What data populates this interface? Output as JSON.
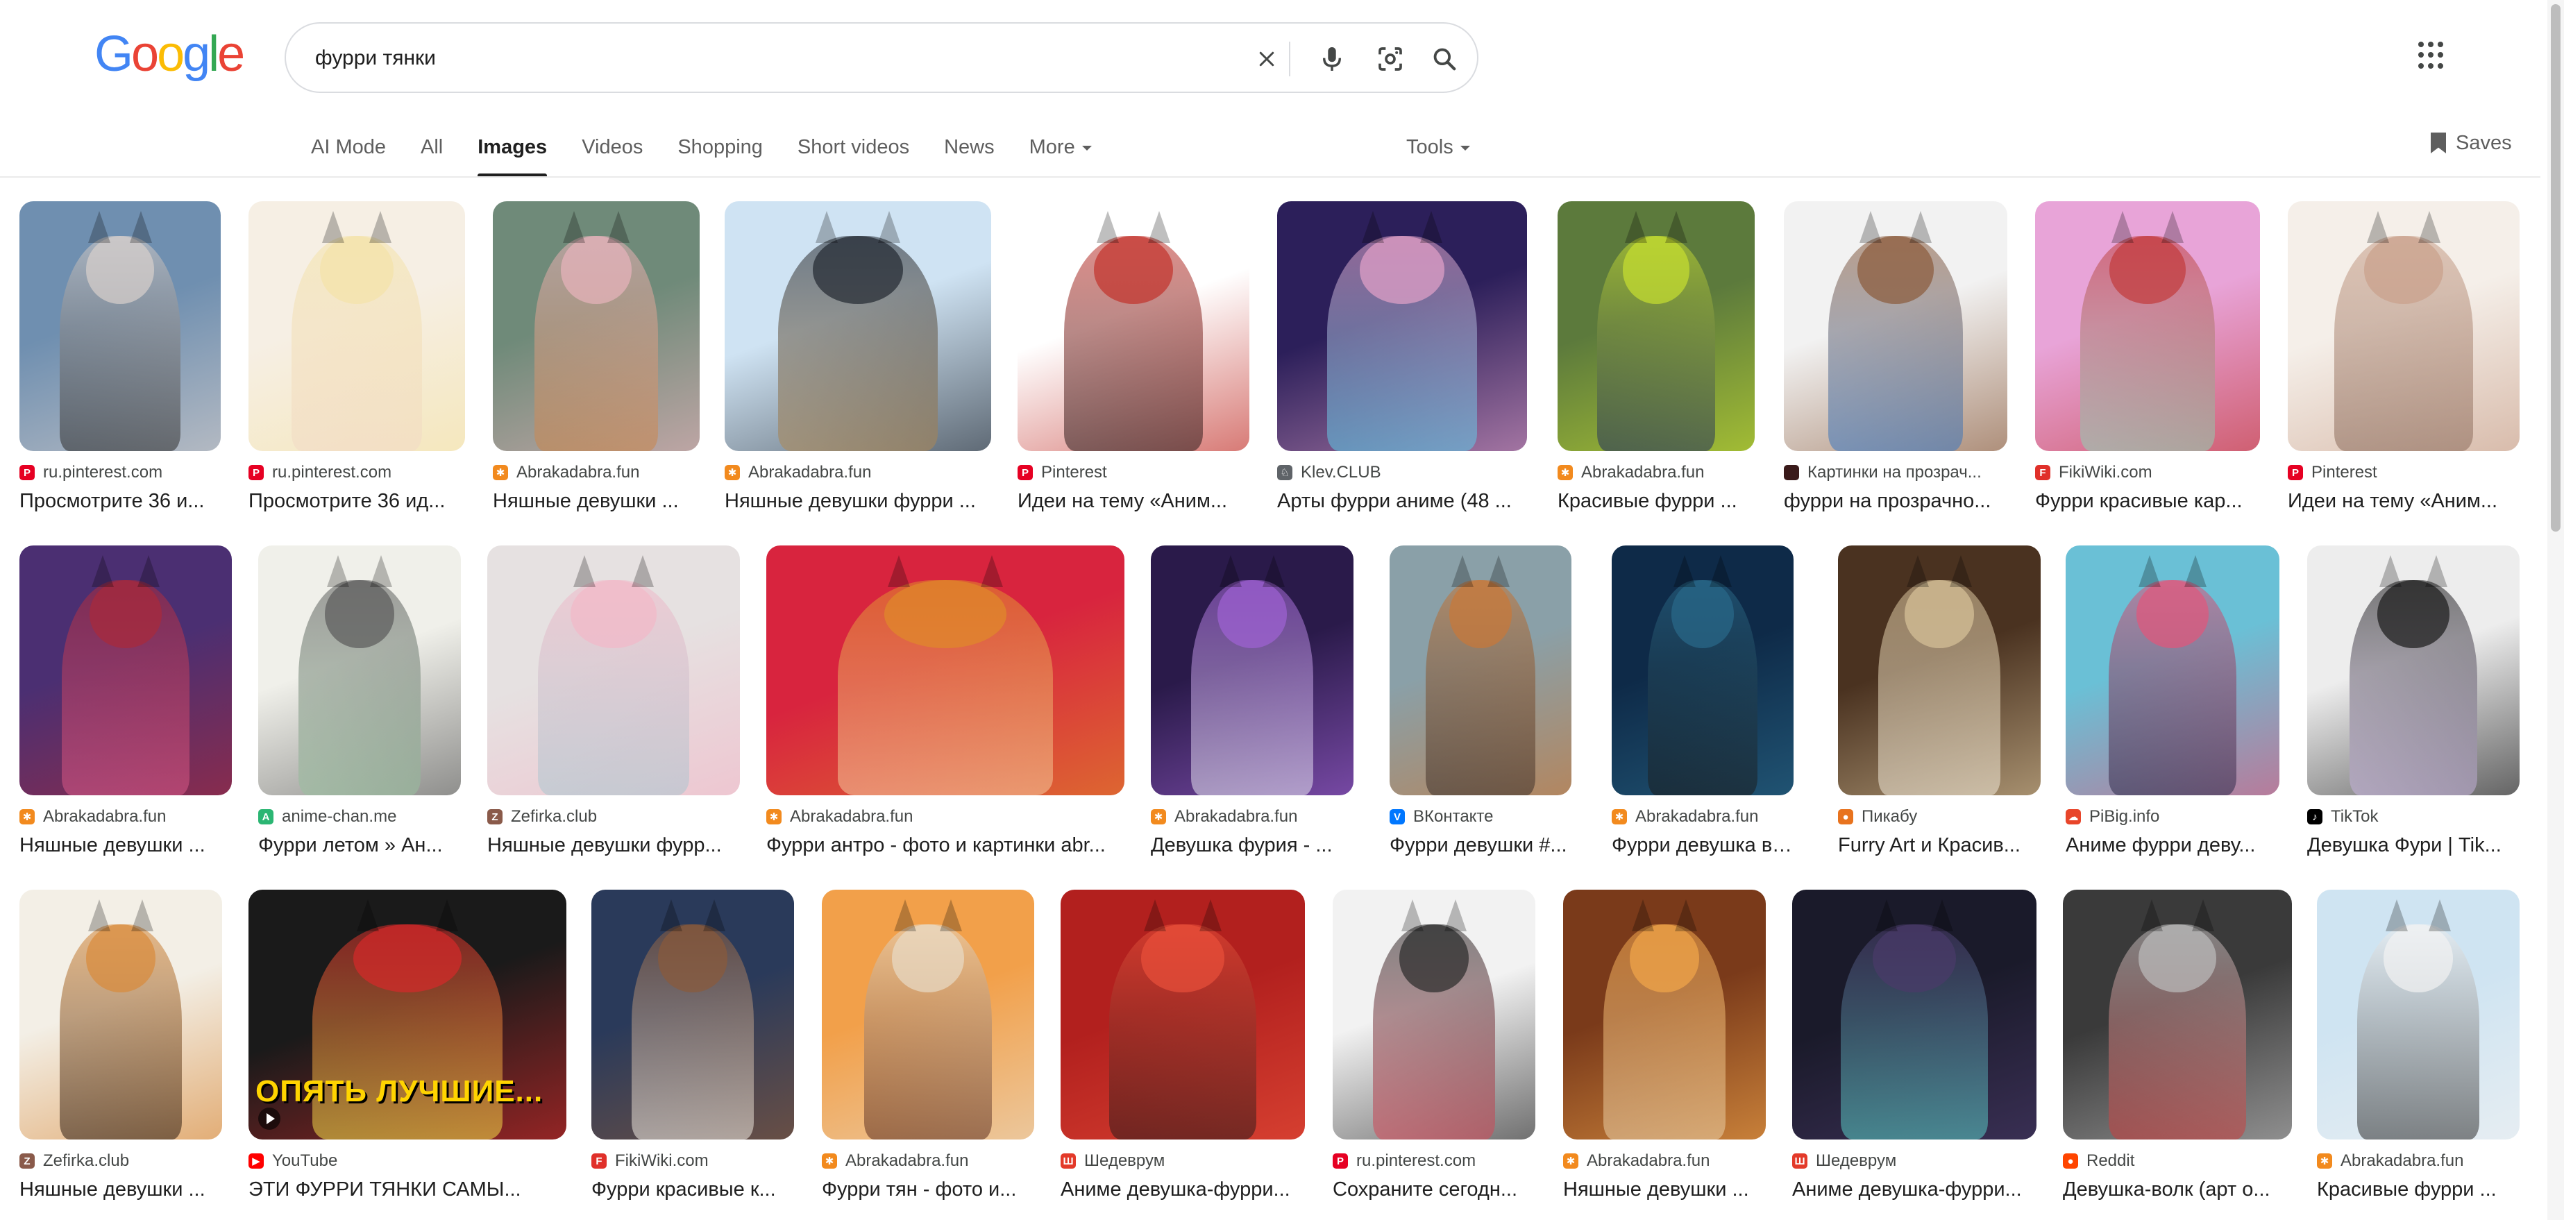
{
  "logo": {
    "letters": [
      "G",
      "o",
      "o",
      "g",
      "l",
      "e"
    ],
    "colors": [
      "#4285F4",
      "#EA4335",
      "#FBBC05",
      "#4285F4",
      "#34A853",
      "#EA4335"
    ]
  },
  "search": {
    "query": "фурри тянки",
    "clear_icon": "close-icon",
    "voice_icon": "mic-icon",
    "lens_icon": "camera-icon",
    "search_icon": "search-icon"
  },
  "tabs": [
    {
      "label": "AI Mode",
      "active": false
    },
    {
      "label": "All",
      "active": false
    },
    {
      "label": "Images",
      "active": true
    },
    {
      "label": "Videos",
      "active": false
    },
    {
      "label": "Shopping",
      "active": false
    },
    {
      "label": "Short videos",
      "active": false
    },
    {
      "label": "News",
      "active": false
    },
    {
      "label": "More",
      "active": false,
      "dropdown": true
    }
  ],
  "tools_label": "Tools",
  "saves_label": "Saves",
  "results": [
    [
      {
        "source": "ru.pinterest.com",
        "fav": "pinterest",
        "title": "Просмотрите 36 и...",
        "colors": [
          "#6f8fb0",
          "#d8d0cc",
          "#2a2a2a"
        ]
      },
      {
        "source": "ru.pinterest.com",
        "fav": "pinterest",
        "title": "Просмотрите 36 ид...",
        "colors": [
          "#f6efe4",
          "#f4e3a8",
          "#f1d9c6"
        ]
      },
      {
        "source": "Abrakadabra.fun",
        "fav": "abrakadabra",
        "title": "Няшные девушки ...",
        "colors": [
          "#6f8a79",
          "#e8b4bc",
          "#c88448"
        ]
      },
      {
        "source": "Abrakadabra.fun",
        "fav": "abrakadabra",
        "title": "Няшные девушки фурри ...",
        "colors": [
          "#cfe3f3",
          "#222831",
          "#b08a55"
        ]
      },
      {
        "source": "Pinterest",
        "fav": "pinterest",
        "title": "Идеи на тему «Аним...",
        "colors": [
          "#ffffff",
          "#c2322b",
          "#2a1c1c"
        ]
      },
      {
        "source": "Klev.CLUB",
        "fav": "klev",
        "title": "Арты фурри аниме (48 ...",
        "colors": [
          "#2c1f5a",
          "#e4a3c9",
          "#5ac9e6"
        ]
      },
      {
        "source": "Abrakadabra.fun",
        "fav": "abrakadabra",
        "title": "Красивые фурри ...",
        "colors": [
          "#5c7a3c",
          "#c8e030",
          "#1d2b5e"
        ]
      },
      {
        "source": "Картинки на прозрач...",
        "fav": "dark",
        "title": "фурри на прозрачно...",
        "colors": [
          "#f2f2f2",
          "#8a5a3a",
          "#3b78c2"
        ]
      },
      {
        "source": "FikiWiki.com",
        "fav": "fikiwiki",
        "title": "Фурри красивые кар...",
        "colors": [
          "#e8a4d8",
          "#c23a3a",
          "#8fd6b8"
        ]
      },
      {
        "source": "Pinterest",
        "fav": "pinterest",
        "title": "Идеи на тему «Аним...",
        "colors": [
          "#f5efe9",
          "#c9a08a",
          "#8a6a5a"
        ]
      }
    ],
    [
      {
        "source": "Abrakadabra.fun",
        "fav": "abrakadabra",
        "title": "Няшные девушки ...",
        "colors": [
          "#4b2f72",
          "#a92a3a",
          "#d95a8a"
        ]
      },
      {
        "source": "anime-chan.me",
        "fav": "animechan",
        "title": "Фурри летом » Ан...",
        "colors": [
          "#f0f0ea",
          "#5a5a5a",
          "#9ac2a0"
        ]
      },
      {
        "source": "Zefirka.club",
        "fav": "zefirka",
        "title": "Няшные девушки фурр...",
        "colors": [
          "#e6e1e1",
          "#f2b8c8",
          "#a9c7d0"
        ]
      },
      {
        "source": "Abrakadabra.fun",
        "fav": "abrakadabra",
        "title": "Фурри антро - фото и картинки abr...",
        "colors": [
          "#d8243e",
          "#e08a2a",
          "#f5c9a0"
        ]
      },
      {
        "source": "Abrakadabra.fun",
        "fav": "abrakadabra",
        "title": "Девушка фурия - ...",
        "colors": [
          "#2a1a4a",
          "#a062d4",
          "#e6e6f0"
        ]
      },
      {
        "source": "ВКонтакте",
        "fav": "vk",
        "title": "Фурри девушки #...",
        "colors": [
          "#8aa0a8",
          "#c97838",
          "#3a2f2a"
        ]
      },
      {
        "source": "Abrakadabra.fun",
        "fav": "abrakadabra",
        "title": "Фурри девушка во...",
        "colors": [
          "#0e2a48",
          "#2a6a8a",
          "#1a1a1a"
        ]
      },
      {
        "source": "Пикабу",
        "fav": "pikabu",
        "title": "Furry Art и Красив...",
        "colors": [
          "#4a3220",
          "#d9c39a",
          "#f0e8d8"
        ]
      },
      {
        "source": "PiBig.info",
        "fav": "pibig",
        "title": "Аниме фурри деву...",
        "colors": [
          "#6ac0d6",
          "#e2557a",
          "#2a2a4a"
        ]
      },
      {
        "source": "TikTok",
        "fav": "tiktok",
        "title": "Девушка Фури | Tik...",
        "colors": [
          "#ededed",
          "#1a1a1a",
          "#c9b6e0"
        ]
      }
    ],
    [
      {
        "source": "Zefirka.club",
        "fav": "zefirka",
        "title": "Няшные девушки ...",
        "colors": [
          "#f3efe6",
          "#d98a3a",
          "#2a1a10"
        ]
      },
      {
        "source": "YouTube",
        "fav": "youtube",
        "title": "ЭТИ ФУРРИ ТЯНКИ САМЫ...",
        "colors": [
          "#1a1a1a",
          "#d62a2a",
          "#f2e04a"
        ],
        "video": true,
        "caption": "ОПЯТЬ ЛУЧШИЕ..."
      },
      {
        "source": "FikiWiki.com",
        "fav": "fikiwiki",
        "title": "Фурри красивые к...",
        "colors": [
          "#2a3a5a",
          "#8a5a3a",
          "#f0ece4"
        ]
      },
      {
        "source": "Abrakadabra.fun",
        "fav": "abrakadabra",
        "title": "Фурри тян - фото и...",
        "colors": [
          "#f2a04a",
          "#e8dcc8",
          "#5a2a1a"
        ]
      },
      {
        "source": "Шедеврум",
        "fav": "shedevrum",
        "title": "Аниме девушка-фурри...",
        "colors": [
          "#b2201e",
          "#e9503a",
          "#2a1a1a"
        ]
      },
      {
        "source": "ru.pinterest.com",
        "fav": "pinterest",
        "title": "Сохраните сегодн...",
        "colors": [
          "#f2f2f2",
          "#2a2a2a",
          "#d84a5a"
        ]
      },
      {
        "source": "Abrakadabra.fun",
        "fav": "abrakadabra",
        "title": "Няшные девушки ...",
        "colors": [
          "#7a3a1a",
          "#f2a64a",
          "#e8cfa8"
        ]
      },
      {
        "source": "Шедеврум",
        "fav": "shedevrum",
        "title": "Аниме девушка-фурри...",
        "colors": [
          "#1a1a2a",
          "#4a3a6a",
          "#5ad0c8"
        ]
      },
      {
        "source": "Reddit",
        "fav": "reddit",
        "title": "Девушка-волк (арт о...",
        "colors": [
          "#3a3a3a",
          "#bdbdbd",
          "#c83a3a"
        ]
      },
      {
        "source": "Abrakadabra.fun",
        "fav": "abrakadabra",
        "title": "Красивые фурри ...",
        "colors": [
          "#cfe4f2",
          "#f2f2f2",
          "#2a2a2a"
        ]
      }
    ]
  ],
  "favicon_colors": {
    "pinterest": "#e60023",
    "abrakadabra": "#f28a1e",
    "klev": "#5f6368",
    "dark": "#3a1a1a",
    "fikiwiki": "#e0302a",
    "animechan": "#2bb673",
    "zefirka": "#8a5a4a",
    "vk": "#0077ff",
    "pikabu": "#e8731e",
    "pibig": "#e8452a",
    "tiktok": "#000000",
    "youtube": "#ff0000",
    "shedevrum": "#e33a2a",
    "reddit": "#ff4500"
  },
  "favicon_glyphs": {
    "pinterest": "P",
    "abrakadabra": "✱",
    "klev": "♘",
    "dark": "",
    "fikiwiki": "F",
    "animechan": "A",
    "zefirka": "Z",
    "vk": "V",
    "pikabu": "●",
    "pibig": "☁",
    "tiktok": "♪",
    "youtube": "▶",
    "shedevrum": "Ш",
    "reddit": "●"
  }
}
